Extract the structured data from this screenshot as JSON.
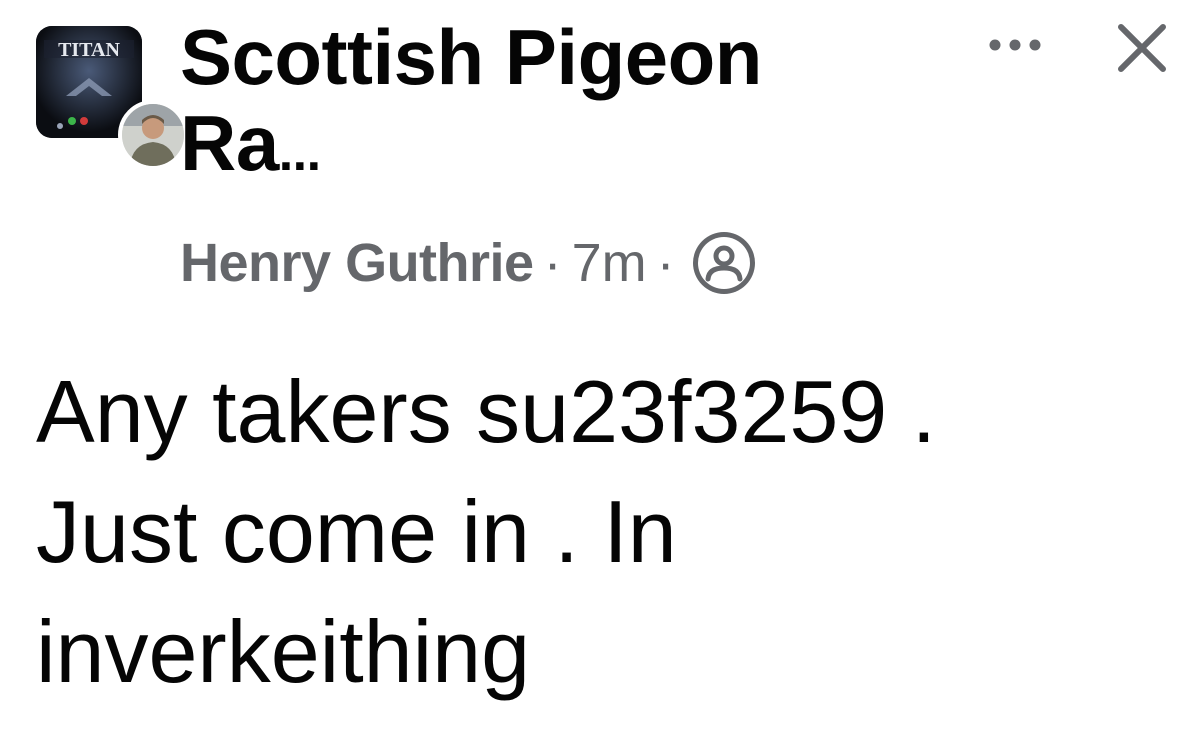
{
  "header": {
    "group_name_line1": "Scottish Pigeon",
    "group_name_line2": "Ra",
    "group_name_ellipsis": "...",
    "group_avatar_text": "TITAN",
    "author": "Henry Guthrie",
    "separator": "·",
    "time": "7m",
    "audience_icon": "members-icon"
  },
  "controls": {
    "more_icon": "more-horizontal-icon",
    "close_icon": "close-icon"
  },
  "post": {
    "line1": "Any takers su23f3259 .",
    "line2": "Just come in . In",
    "line3": "inverkeithing"
  },
  "colors": {
    "primary_text": "#050505",
    "secondary_text": "#65676b",
    "background": "#ffffff"
  }
}
